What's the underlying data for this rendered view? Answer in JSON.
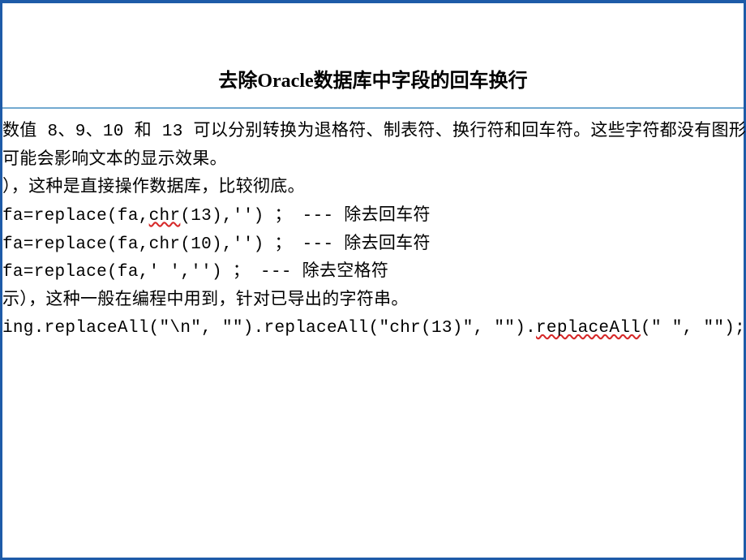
{
  "document": {
    "title": "去除Oracle数据库中字段的回车换行",
    "lines": {
      "l1a": "数值 8、9、10 和 13 可以分别转换为退格符、制表符、换行符和回车符。这些字符都没有图形表示，但",
      "l2": "可能会影响文本的显示效果。",
      "l3": "），这种是直接操作数据库，比较彻底。",
      "l4_pre": "fa=replace(fa,",
      "l4_chr": "chr",
      "l4_post": "(13),'') ； --- 除去回车符",
      "l5": "fa=replace(fa,chr(10),'') ； --- 除去回车符",
      "l6": "fa=replace(fa,' ','') ； --- 除去空格符",
      "l7": "示），这种一般在编程中用到，针对已导出的字符串。",
      "l8_pre": "ing.replaceAll(\"\\n\", \"\").replaceAll(\"chr(13)\", \"\").",
      "l8_wavy": "replaceAll",
      "l8_post": "(\" \", \"\");"
    }
  }
}
